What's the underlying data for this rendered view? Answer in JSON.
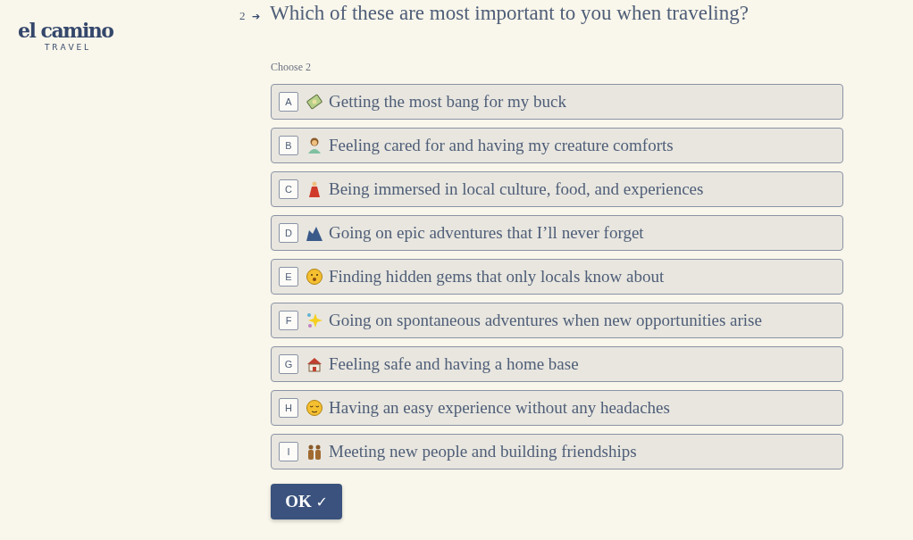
{
  "logo": {
    "name": "el camino",
    "tagline": "T R A V E L"
  },
  "question": {
    "number": "2",
    "arrow": "➔",
    "text": "Which of these are most important to you when traveling?",
    "hint": "Choose 2"
  },
  "options": [
    {
      "key": "A",
      "label": "Getting the most bang for my buck",
      "selected": false
    },
    {
      "key": "B",
      "label": "Feeling cared for and having my creature comforts",
      "selected": false
    },
    {
      "key": "C",
      "label": "Being immersed in local culture, food, and experiences",
      "selected": false
    },
    {
      "key": "D",
      "label": "Going on epic adventures that I’ll never forget",
      "selected": false
    },
    {
      "key": "E",
      "label": "Finding hidden gems that only locals know about",
      "selected": false
    },
    {
      "key": "F",
      "label": "Going on spontaneous adventures when new opportunities arise",
      "selected": false
    },
    {
      "key": "G",
      "label": "Feeling safe and having a home base",
      "selected": false
    },
    {
      "key": "H",
      "label": "Having an easy experience without any headaches",
      "selected": false
    },
    {
      "key": "I",
      "label": "Meeting new people and building friendships",
      "selected": false
    }
  ],
  "ok_button": {
    "label": "OK",
    "icon": "✓"
  }
}
